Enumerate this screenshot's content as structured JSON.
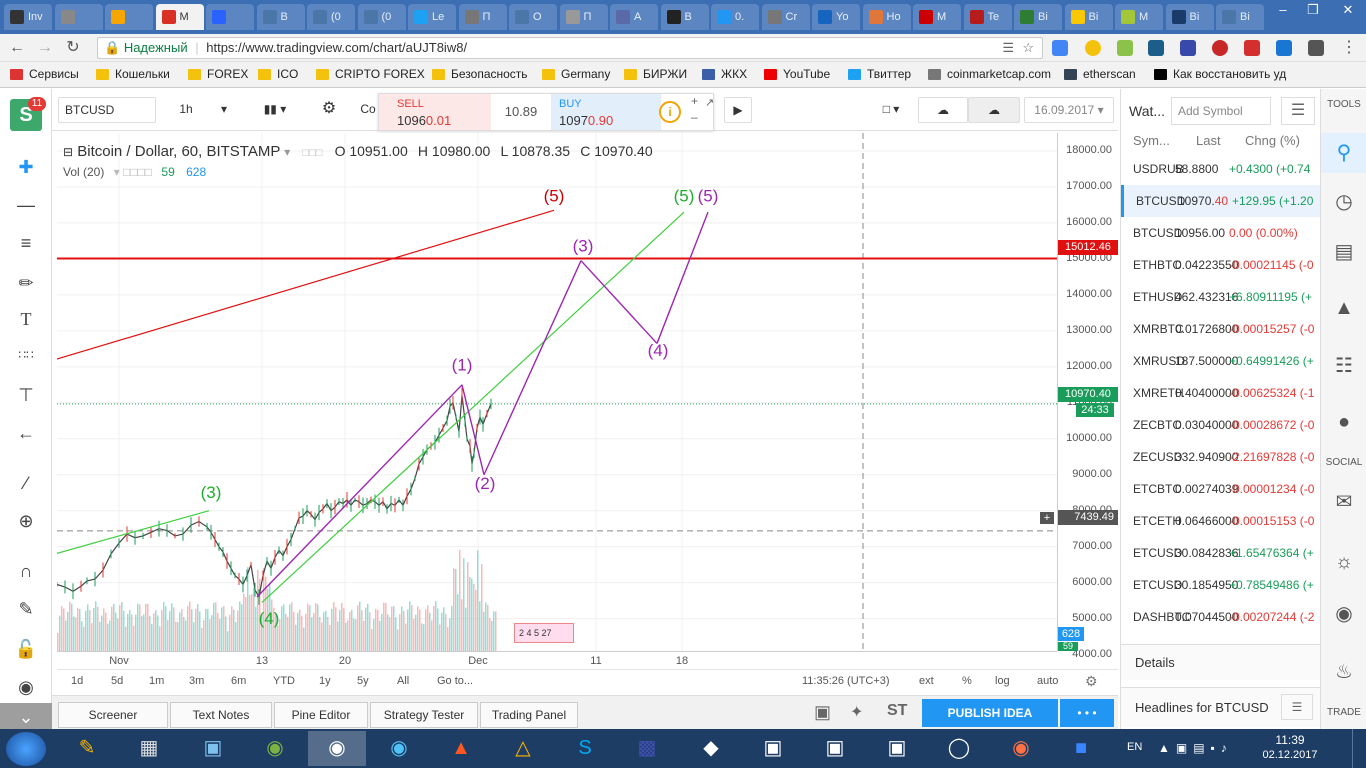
{
  "browser": {
    "tabs": [
      {
        "label": "Inv",
        "color": "#333333"
      },
      {
        "label": "",
        "color": "#888888"
      },
      {
        "label": "",
        "color": "#f7a600"
      },
      {
        "label": "M",
        "color": "#d93025"
      },
      {
        "label": "",
        "color": "#2962ff"
      },
      {
        "label": "B",
        "color": "#4a76a8"
      },
      {
        "label": "(0",
        "color": "#4a76a8"
      },
      {
        "label": "(0",
        "color": "#4a76a8"
      },
      {
        "label": "Le",
        "color": "#1da1f2"
      },
      {
        "label": "П",
        "color": "#777777"
      },
      {
        "label": "О",
        "color": "#4a76a8"
      },
      {
        "label": "П",
        "color": "#999999"
      },
      {
        "label": "А",
        "color": "#5a6aa8"
      },
      {
        "label": "В",
        "color": "#222222"
      },
      {
        "label": "0.",
        "color": "#2196f3"
      },
      {
        "label": "Cr",
        "color": "#777777"
      },
      {
        "label": "Yo",
        "color": "#1565c0"
      },
      {
        "label": "Ho",
        "color": "#e0763a"
      },
      {
        "label": "M",
        "color": "#cc0000"
      },
      {
        "label": "Te",
        "color": "#b71c1c"
      },
      {
        "label": "Bi",
        "color": "#2e7d32"
      },
      {
        "label": "Bi",
        "color": "#f9c800"
      },
      {
        "label": "M",
        "color": "#a4c639"
      },
      {
        "label": "Bi",
        "color": "#1a3a6a"
      },
      {
        "label": "Bi",
        "color": "#4a76a8"
      }
    ],
    "secure_label": "Надежный",
    "url": "https://www.tradingview.com/chart/aUJT8iw8/",
    "bookmarks": [
      "Сервисы",
      "Кошельки",
      "FOREX",
      "ICO",
      "CRIPTO FOREX",
      "Безопасность",
      "Germany",
      "БИРЖИ",
      "ЖКХ",
      "YouTube",
      "Твиттер",
      "coinmarketcap.com",
      "etherscan",
      "Как восстановить уд"
    ]
  },
  "toolbar": {
    "symbol": "BTCUSD",
    "interval": "1h",
    "sell_label": "SELL",
    "sell_price_main": "1096",
    "sell_price_tail": "0.01",
    "spread": "10.89",
    "buy_label": "BUY",
    "buy_price_main": "1097",
    "buy_price_tail": "0.90",
    "date": "16.09.2017",
    "compare_short": "Co"
  },
  "chart": {
    "legend_title": "Bitcoin / Dollar, 60, BITSTAMP",
    "ohlc": {
      "o": "O 10951.00",
      "h": "H 10980.00",
      "l": "L 10878.35",
      "c": "C 10970.40"
    },
    "vol_label": "Vol (20)",
    "vol_val1": "59",
    "vol_val2": "628",
    "price_label": "10970.40",
    "countdown": "24:33",
    "red_line_label": "15012.46",
    "crosshair_label": "7439.49",
    "vol_axis_label": "628",
    "vol_axis_label2": "59",
    "wave_labels": {
      "green3": "(3)",
      "green4": "(4)",
      "green5": "(5)",
      "red5": "(5)",
      "p1": "(1)",
      "p2": "(2)",
      "p3": "(3)",
      "p4": "(4)",
      "p5": "(5)"
    },
    "event_marks": "2  4  5  27"
  },
  "chart_data": {
    "type": "line",
    "title": "Bitcoin / Dollar, 60, BITSTAMP",
    "xlabel": "",
    "ylabel": "",
    "ylim": [
      4100,
      18500
    ],
    "y_ticks": [
      18000,
      17000,
      16000,
      15000,
      14000,
      13000,
      12000,
      11000,
      10000,
      9000,
      8000,
      7000,
      6000,
      5000,
      4000
    ],
    "x_ticks": [
      "Nov",
      "13",
      "20",
      "Dec",
      "11",
      "18"
    ],
    "series": [
      {
        "values": [
          [
            0,
            5950
          ],
          [
            8,
            5880
          ],
          [
            16,
            5760
          ],
          [
            24,
            5900
          ],
          [
            30,
            6050
          ],
          [
            38,
            6100
          ],
          [
            46,
            6350
          ],
          [
            54,
            6800
          ],
          [
            62,
            7100
          ],
          [
            70,
            7350
          ],
          [
            78,
            7250
          ],
          [
            86,
            7300
          ],
          [
            94,
            7400
          ],
          [
            102,
            7500
          ],
          [
            110,
            7450
          ],
          [
            118,
            7300
          ],
          [
            126,
            7350
          ],
          [
            134,
            7600
          ],
          [
            142,
            7700
          ],
          [
            150,
            7550
          ],
          [
            154,
            7400
          ],
          [
            158,
            7200
          ],
          [
            162,
            7000
          ],
          [
            166,
            6850
          ],
          [
            170,
            6600
          ],
          [
            174,
            6400
          ],
          [
            178,
            6200
          ],
          [
            182,
            6100
          ],
          [
            186,
            5950
          ],
          [
            190,
            6200
          ],
          [
            194,
            6500
          ],
          [
            198,
            5800
          ],
          [
            202,
            5600
          ],
          [
            206,
            6200
          ],
          [
            210,
            6600
          ],
          [
            214,
            6400
          ],
          [
            218,
            6700
          ],
          [
            222,
            6900
          ],
          [
            226,
            6750
          ],
          [
            230,
            7000
          ],
          [
            234,
            7200
          ],
          [
            238,
            7500
          ],
          [
            242,
            7800
          ],
          [
            246,
            7850
          ],
          [
            250,
            8000
          ],
          [
            254,
            7900
          ],
          [
            258,
            7750
          ],
          [
            262,
            7950
          ],
          [
            266,
            8050
          ],
          [
            270,
            8200
          ],
          [
            274,
            8000
          ],
          [
            278,
            8100
          ],
          [
            282,
            8250
          ],
          [
            286,
            8200
          ],
          [
            290,
            8300
          ],
          [
            294,
            8150
          ],
          [
            298,
            8300
          ],
          [
            302,
            8250
          ],
          [
            306,
            8150
          ],
          [
            310,
            8200
          ],
          [
            314,
            8300
          ],
          [
            318,
            8250
          ],
          [
            322,
            8150
          ],
          [
            326,
            8250
          ],
          [
            330,
            8050
          ],
          [
            334,
            8200
          ],
          [
            338,
            8150
          ],
          [
            342,
            8300
          ],
          [
            346,
            8150
          ],
          [
            350,
            8400
          ],
          [
            354,
            8600
          ],
          [
            358,
            8900
          ],
          [
            362,
            9300
          ],
          [
            366,
            9500
          ],
          [
            370,
            9700
          ],
          [
            374,
            9800
          ],
          [
            378,
            9900
          ],
          [
            382,
            10100
          ],
          [
            386,
            10300
          ],
          [
            390,
            10500
          ],
          [
            393,
            10900
          ],
          [
            396,
            11000
          ],
          [
            399,
            10600
          ],
          [
            402,
            10200
          ],
          [
            405,
            11200
          ],
          [
            408,
            10500
          ],
          [
            410,
            10000
          ],
          [
            413,
            9800
          ],
          [
            415,
            9300
          ],
          [
            417,
            9600
          ],
          [
            420,
            10300
          ],
          [
            423,
            10600
          ],
          [
            426,
            10400
          ],
          [
            430,
            10700
          ],
          [
            434,
            10970
          ]
        ],
        "name": ""
      },
      {
        "name": "",
        "values": [
          [
            500,
            0
          ]
        ],
        "note_type": "volume"
      }
    ],
    "drawings": {
      "red_trend_line": [
        [
          -2,
          12200
        ],
        [
          497,
          16350
        ]
      ],
      "red_horizontal_line": 15012.46,
      "green_channel_lower": [
        [
          -2,
          6800
        ],
        [
          152,
          8000
        ]
      ],
      "green_channel_upper": [
        [
          205,
          5450
        ],
        [
          627,
          16300
        ]
      ],
      "green_wave_3": [
        [
          152,
          8000
        ]
      ],
      "purple_waves": [
        [
          200,
          5600
        ],
        [
          405,
          11500
        ],
        [
          427,
          9000
        ],
        [
          524,
          14950
        ],
        [
          600,
          12650
        ],
        [
          651,
          16300
        ]
      ]
    }
  },
  "time_axis": [
    "Nov",
    "13",
    "20",
    "Dec",
    "11",
    "18"
  ],
  "price_axis": [
    "18000.00",
    "17000.00",
    "16000.00",
    "15000.00",
    "14000.00",
    "13000.00",
    "12000.00",
    "11000.00",
    "10000.00",
    "9000.00",
    "8000.00",
    "7000.00",
    "6000.00",
    "5000.00",
    "4000.00"
  ],
  "range_bar": {
    "ranges": [
      "1d",
      "5d",
      "1m",
      "3m",
      "6m",
      "YTD",
      "1y",
      "5y",
      "All",
      "Go to..."
    ],
    "time": "11:35:26 (UTC+3)",
    "options": [
      "ext",
      "%",
      "log",
      "auto"
    ]
  },
  "bottom": {
    "tabs": [
      "Screener",
      "Text Notes",
      "Pine Editor",
      "Strategy Tester",
      "Trading Panel"
    ],
    "st_label": "ST",
    "publish": "PUBLISH IDEA",
    "more": "• • •"
  },
  "watchlist": {
    "title": "Wat...",
    "add_placeholder": "Add Symbol",
    "headers": {
      "sym": "Sym...",
      "last": "Last",
      "chg": "Chng (%)"
    },
    "rows": [
      {
        "sym": "USDRUB",
        "last": "58.8800",
        "chg": "+0.4300 (+0.74",
        "dir": "up"
      },
      {
        "sym": "BTCUSD",
        "last_main": "10970.",
        "last_tail": "40",
        "chg": "+129.95 (+1.20",
        "dir": "up",
        "selected": true
      },
      {
        "sym": "BTCUSD",
        "last": "10956.00",
        "chg": "0.00 (0.00%)",
        "dir": "down"
      },
      {
        "sym": "ETHBTC",
        "last": "0.04223550",
        "chg": "-0.00021145 (-0",
        "dir": "down"
      },
      {
        "sym": "ETHUSD",
        "last": "462.432316",
        "chg": "+6.80911195 (+",
        "dir": "up"
      },
      {
        "sym": "XMRBTC",
        "last": "0.01726800",
        "chg": "-0.00015257 (-0",
        "dir": "down"
      },
      {
        "sym": "XMRUSD",
        "last": "187.500000",
        "chg": "+0.64991426 (+",
        "dir": "up"
      },
      {
        "sym": "XMRETH",
        "last": "0.40400000",
        "chg": "-0.00625324 (-1",
        "dir": "down"
      },
      {
        "sym": "ZECBTC",
        "last": "0.03040000",
        "chg": "-0.00028672 (-0",
        "dir": "down"
      },
      {
        "sym": "ZECUSD",
        "last": "332.940900",
        "chg": "-2.21697828 (-0",
        "dir": "down"
      },
      {
        "sym": "ETCBTC",
        "last": "0.00274039",
        "chg": "-0.00001234 (-0",
        "dir": "down"
      },
      {
        "sym": "ETCETH",
        "last": "0.06466000",
        "chg": "-0.00015153 (-0",
        "dir": "down"
      },
      {
        "sym": "ETCUSD",
        "last": "30.0842836",
        "chg": "+1.65476364 (+",
        "dir": "up"
      },
      {
        "sym": "ETCUSD",
        "last": "30.1854950",
        "chg": "+0.78549486 (+",
        "dir": "up"
      },
      {
        "sym": "DASHBTC",
        "last": "0.07044500",
        "chg": "-0.00207244 (-2",
        "dir": "down"
      }
    ],
    "details": "Details",
    "headlines": "Headlines for BTCUSD"
  },
  "rightbar": {
    "tools": "TOOLS",
    "social": "SOCIAL",
    "trade": "TRADE"
  },
  "taskbar": {
    "lang": "EN",
    "time": "11:39",
    "date": "02.12.2017"
  },
  "colors": {
    "up": "#1a9c5a",
    "down": "#e53935",
    "accent": "#2196f3",
    "red_line": "#e01010",
    "purple": "#9c27b0",
    "green": "#3fcf3f"
  },
  "badge_count": "11"
}
